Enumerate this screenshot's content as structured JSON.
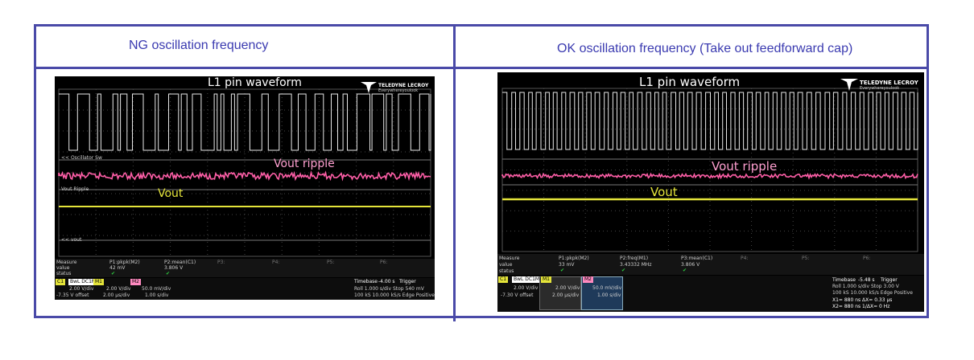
{
  "headers": {
    "left": "NG oscillation frequency",
    "right": "OK oscillation frequency (Take out feedforward cap)"
  },
  "colors": {
    "border": "#4a4aa8",
    "header_text": "#3a3ab0",
    "trace_pin": "#e8e8e8",
    "trace_ripple": "#ff5fa8",
    "trace_vout": "#e4e43a",
    "chip_c1": "#e4e43a",
    "chip_m2": "#ff8ac0"
  },
  "scope_ng": {
    "brand": "TELEDYNE LECROY",
    "brand_sub": "Everywhereyoulook",
    "pin_label": "L1 pin waveform",
    "ripple_label": "Vout ripple",
    "vout_label": "Vout",
    "ch_pin": "<< Oscillator Sw",
    "ch_ripple": "Vout Ripple",
    "ch_vout": "<< vout",
    "meas_header": [
      "Measure",
      "P1:pkpk(M2)",
      "P2:mean(C1)",
      "P3:",
      "P4:",
      "P5:",
      "P6:"
    ],
    "meas_value": [
      "value",
      "42 mV",
      "3.806 V"
    ],
    "meas_status": "status",
    "chips": {
      "c1": "C1",
      "c1_mode": "BwL DC1M",
      "m1": "M1",
      "m2": "M2",
      "c1_scale": "2.00 V/div",
      "c1_offset": "-7.35 V offset",
      "m1_scale": "2.00 V/div",
      "m1_time": "2.00 µs/div",
      "m2_scale": "50.0 mV/div",
      "m2_time": "1.00 s/div"
    },
    "timebase": {
      "label": "Timebase",
      "value": "-4.00 s",
      "trigger": "Trigger",
      "row2": "Roll  1.000 s/div  Stop  540 mV",
      "row3": "100 kS 10.000 kS/s  Edge  Positive"
    }
  },
  "scope_ok": {
    "brand": "TELEDYNE LECROY",
    "brand_sub": "Everywhereyoulook",
    "pin_label": "L1 pin waveform",
    "ripple_label": "Vout ripple",
    "vout_label": "Vout",
    "meas_header": [
      "Measure",
      "P1:pkpk(M2)",
      "P2:freq(M1)",
      "P3:mean(C1)",
      "P4:",
      "P5:",
      "P6:"
    ],
    "meas_value": [
      "value",
      "33 mV",
      "3.43332 MHz",
      "3.806 V"
    ],
    "meas_status": "status",
    "chips": {
      "c1": "C1",
      "c1_mode": "BwL DC1M",
      "m1": "M1",
      "m2": "M2",
      "c1_scale": "2.00 V/div",
      "c1_offset": "-7.30 V offset",
      "m1_scale": "2.00 V/div",
      "m1_time": "2.00 µs/div",
      "m2_scale": "50.0 mV/div",
      "m2_time": "1.00 s/div"
    },
    "timebase": {
      "label": "Timebase",
      "value": "-5.48 s",
      "trigger": "Trigger",
      "row2": "Roll  1.000 s/div  Stop  3.00 V",
      "row3": "100 kS 10.000 kS/s  Edge  Positive",
      "row4": "X1= 880 ns  ΔX= 0.33 µs",
      "row5": "X2= 880 ns  1/ΔX= 0 Hz"
    }
  }
}
